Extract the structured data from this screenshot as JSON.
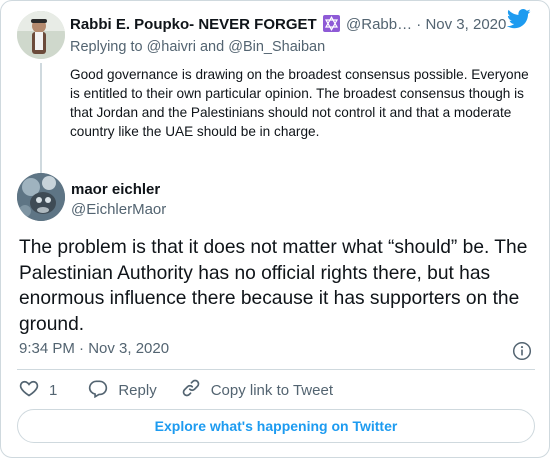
{
  "parent_tweet": {
    "display_name": "Rabbi E. Poupko- NEVER FORGET",
    "handle": "@Rabb…",
    "separator": "·",
    "date": "Nov 3, 2020",
    "replying_prefix": "Replying to",
    "replying_to_1": "@haivri",
    "replying_and": "and",
    "replying_to_2": "@Bin_Shaiban",
    "text": "Good governance is drawing on the broadest consensus possible. Everyone is entitled to their own particular opinion. The broadest consensus though is that Jordan and the Palestinians should not control it and that a moderate country like the UAE should be in charge."
  },
  "main_tweet": {
    "display_name": "maor eichler",
    "handle": "@EichlerMaor",
    "text": "The problem is that it does not matter what “should” be. The Palestinian Authority has no official rights there, but has enormous influence there because it has supporters on the ground.",
    "timestamp": "9:34 PM · Nov 3, 2020"
  },
  "actions": {
    "like_count": "1",
    "reply_label": "Reply",
    "copy_link_label": "Copy link to Tweet"
  },
  "explore_label": "Explore what's happening on Twitter",
  "colors": {
    "twitter_blue": "#1d9bf0",
    "star_of_david": "#8e5ad6",
    "secondary_text": "#536471"
  },
  "icons": [
    "star-of-david-icon",
    "twitter-bird-icon",
    "info-icon",
    "heart-icon",
    "reply-icon",
    "link-icon"
  ]
}
